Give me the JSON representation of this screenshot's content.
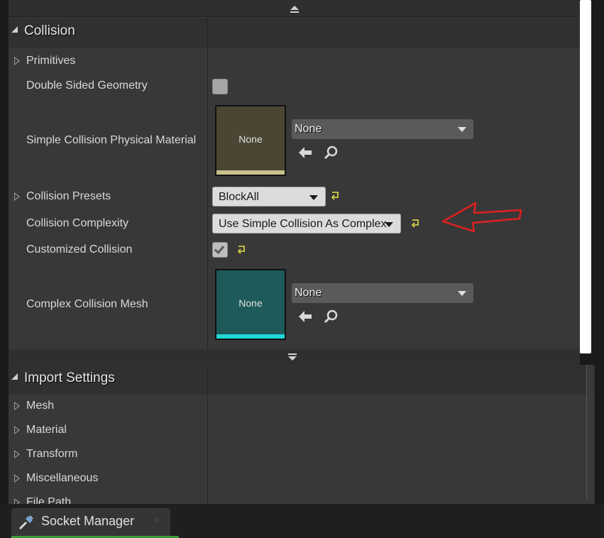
{
  "collision": {
    "title": "Collision",
    "properties": {
      "primitives": "Primitives",
      "double_sided_geometry": "Double Sided Geometry",
      "simple_collision_physical_material": "Simple Collision Physical Material",
      "collision_presets": "Collision Presets",
      "collision_complexity": "Collision Complexity",
      "customized_collision": "Customized Collision",
      "complex_collision_mesh": "Complex Collision Mesh"
    },
    "physical_material": {
      "thumbnail_label": "None",
      "value": "None"
    },
    "presets_value": "BlockAll",
    "complexity_value": "Use Simple Collision As Complex",
    "customized_collision_checked": true,
    "double_sided_checked": false,
    "complex_mesh": {
      "thumbnail_label": "None",
      "value": "None"
    }
  },
  "import_settings": {
    "title": "Import Settings",
    "items": [
      "Mesh",
      "Material",
      "Transform",
      "Miscellaneous",
      "File Path"
    ]
  },
  "tabs": {
    "socket_manager": "Socket Manager"
  },
  "colors": {
    "panel_bg": "#383838",
    "accent_reset": "#e5e04a",
    "annotation_red": "#e02020",
    "physical_material_thumb": "#4a4633",
    "mesh_thumb": "#1e5a5a",
    "tab_active": "#3a9a3a"
  }
}
